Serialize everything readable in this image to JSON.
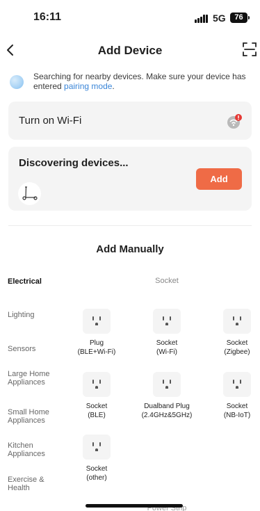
{
  "status_bar": {
    "time": "16:11",
    "network": "5G",
    "battery": "76"
  },
  "header": {
    "title": "Add Device"
  },
  "search": {
    "text": "Searching for nearby devices. Make sure your device has entered ",
    "link": "pairing mode",
    "suffix": "."
  },
  "wifi": {
    "label": "Turn on Wi-Fi"
  },
  "discovering": {
    "title": "Discovering devices...",
    "add_label": "Add"
  },
  "manual": {
    "title": "Add Manually",
    "categories": [
      {
        "label": "Electrical",
        "active": true
      },
      {
        "label": "Lighting"
      },
      {
        "label": "Sensors"
      },
      {
        "label": "Large Home Appliances"
      },
      {
        "label": "Small Home Appliances"
      },
      {
        "label": "Kitchen Appliances"
      },
      {
        "label": "Exercise & Health"
      }
    ],
    "group_title": "Socket",
    "devices": [
      {
        "line1": "Plug",
        "line2": "(BLE+Wi-Fi)"
      },
      {
        "line1": "Socket",
        "line2": "(Wi-Fi)"
      },
      {
        "line1": "Socket",
        "line2": "(Zigbee)"
      },
      {
        "line1": "Socket",
        "line2": "(BLE)"
      },
      {
        "line1": "Dualband Plug",
        "line2": "(2.4GHz&5GHz)"
      },
      {
        "line1": "Socket",
        "line2": "(NB-IoT)"
      },
      {
        "line1": "Socket",
        "line2": "(other)"
      }
    ],
    "next_group_title": "Power Strip"
  },
  "colors": {
    "accent": "#ef6b46",
    "link": "#3b86d8",
    "card": "#f4f4f4",
    "alert": "#e53935"
  }
}
